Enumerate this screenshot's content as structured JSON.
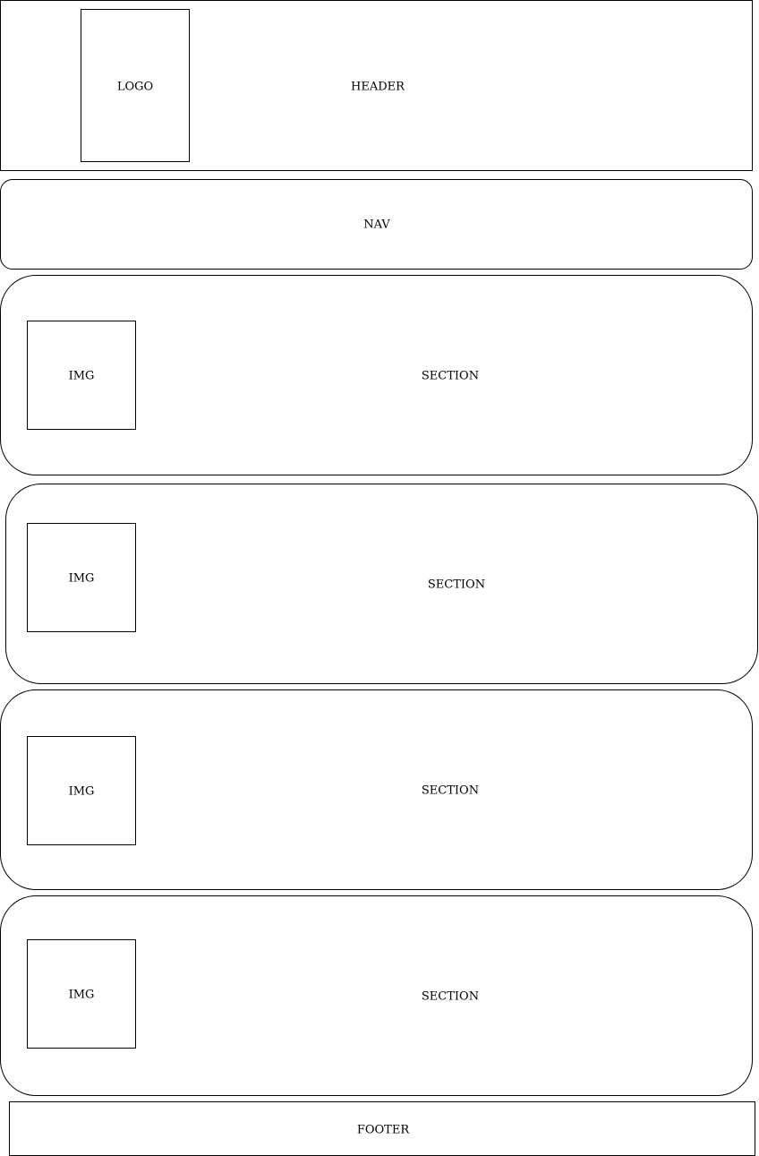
{
  "header": {
    "label": "HEADER",
    "logo_label": "LOGO"
  },
  "nav": {
    "label": "NAV"
  },
  "sections": [
    {
      "label": "SECTION",
      "img_label": "IMG"
    },
    {
      "label": "SECTION",
      "img_label": "IMG"
    },
    {
      "label": "SECTION",
      "img_label": "IMG"
    },
    {
      "label": "SECTION",
      "img_label": "IMG"
    }
  ],
  "footer": {
    "label": "FOOTER"
  }
}
